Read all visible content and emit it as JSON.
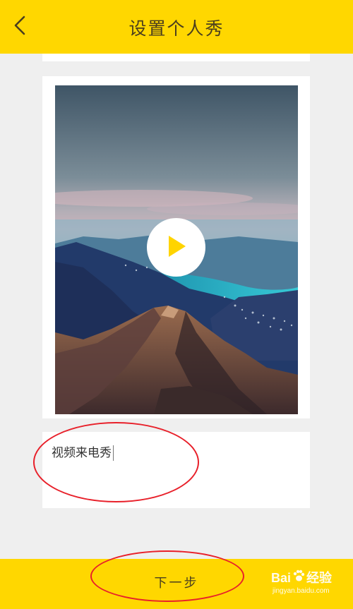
{
  "header": {
    "title": "设置个人秀",
    "back_icon": "chevron-left-icon"
  },
  "video": {
    "thumbnail": "mountain-lake-landscape",
    "play_icon": "play-icon"
  },
  "caption": {
    "value": "视频来电秀"
  },
  "footer": {
    "next_label": "下一步"
  },
  "watermark": {
    "brand_left": "Bai",
    "brand_right": "经验",
    "url": "jingyan.baidu.com"
  },
  "colors": {
    "accent": "#ffd700",
    "annotation": "#e8202a",
    "play": "#ffd400"
  }
}
